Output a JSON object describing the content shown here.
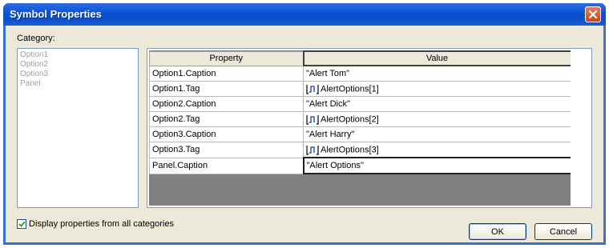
{
  "window": {
    "title": "Symbol Properties"
  },
  "category": {
    "label": "Category:",
    "items": [
      "Option1",
      "Option2",
      "Option3",
      "Panel"
    ]
  },
  "grid": {
    "headers": {
      "property": "Property",
      "value": "Value"
    },
    "rows": [
      {
        "property": "Option1.Caption",
        "value": "\"Alert Tom\"",
        "icon": false
      },
      {
        "property": "Option1.Tag",
        "value": "AlertOptions[1]",
        "icon": true
      },
      {
        "property": "Option2.Caption",
        "value": "\"Alert Dick\"",
        "icon": false
      },
      {
        "property": "Option2.Tag",
        "value": "AlertOptions[2]",
        "icon": true
      },
      {
        "property": "Option3.Caption",
        "value": "\"Alert Harry\"",
        "icon": false
      },
      {
        "property": "Option3.Tag",
        "value": "AlertOptions[3]",
        "icon": true
      },
      {
        "property": "Panel.Caption",
        "value": "\"Alert Options\"",
        "icon": false
      }
    ]
  },
  "footer": {
    "checkbox_label": "Display properties from all categories",
    "checkbox_checked": true,
    "ok_label": "OK",
    "cancel_label": "Cancel"
  }
}
